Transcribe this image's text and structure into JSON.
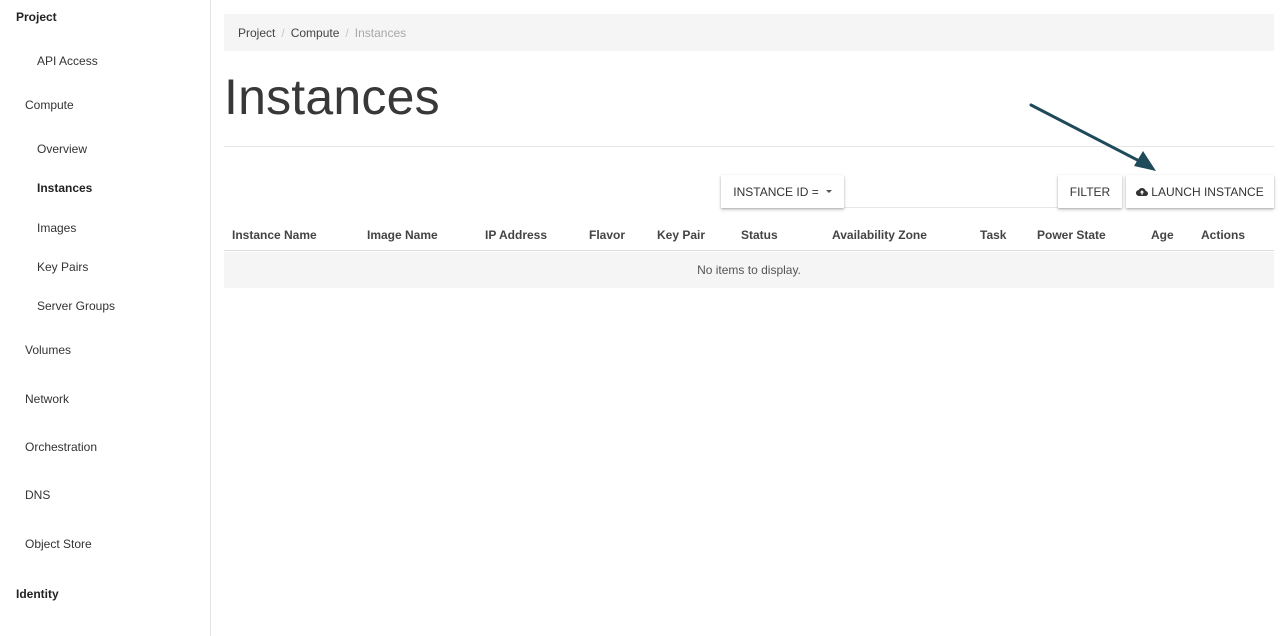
{
  "sidebar": {
    "project": "Project",
    "api_access": "API Access",
    "compute": "Compute",
    "overview": "Overview",
    "instances": "Instances",
    "images": "Images",
    "key_pairs": "Key Pairs",
    "server_groups": "Server Groups",
    "volumes": "Volumes",
    "network": "Network",
    "orchestration": "Orchestration",
    "dns": "DNS",
    "object_store": "Object Store",
    "identity": "Identity"
  },
  "breadcrumb": {
    "items": [
      "Project",
      "Compute",
      "Instances"
    ],
    "separator": "/"
  },
  "page": {
    "title": "Instances"
  },
  "toolbar": {
    "filter_field_label": "INSTANCE ID =",
    "filter_label": "FILTER",
    "launch_label": "LAUNCH INSTANCE",
    "launch_icon": "cloud-upload-icon"
  },
  "table": {
    "columns": [
      "Instance Name",
      "Image Name",
      "IP Address",
      "Flavor",
      "Key Pair",
      "Status",
      "Availability Zone",
      "Task",
      "Power State",
      "Age",
      "Actions"
    ],
    "empty_message": "No items to display."
  },
  "colors": {
    "arrow": "#1f4a5a",
    "breadcrumb_bg": "#f5f5f5",
    "empty_row_bg": "#f5f5f5"
  }
}
